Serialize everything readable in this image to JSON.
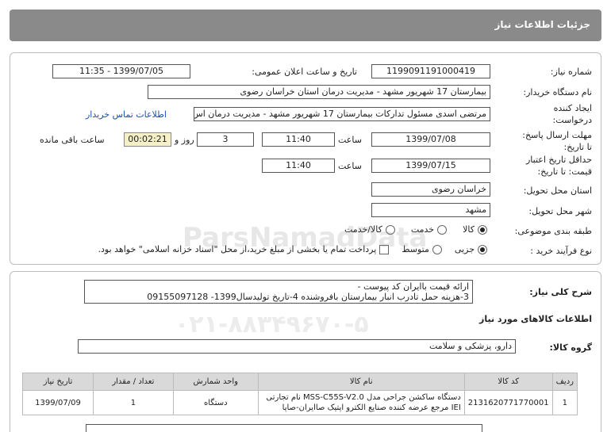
{
  "header": {
    "title": "جزئیات اطلاعات نیاز"
  },
  "need_number": {
    "label": "شماره نیاز:",
    "value": "1199091191000419"
  },
  "announce": {
    "label": "تاریخ و ساعت اعلان عمومی:",
    "value": "1399/07/05 - 11:35"
  },
  "buyer": {
    "label": "نام دستگاه خریدار:",
    "value": "بیمارستان 17 شهریور مشهد - مدیریت درمان استان خراسان رضوی"
  },
  "creator": {
    "label1": "ایجاد کننده",
    "label2": "درخواست:",
    "value": "مرتضی اسدی مسئول تدارکات بیمارستان 17 شهریور مشهد - مدیریت درمان اس",
    "contact_link": "اطلاعات تماس خریدار"
  },
  "deadline": {
    "label1": "مهلت ارسال پاسخ:",
    "label2": "تا تاریخ:",
    "date": "1399/07/08",
    "time_label": "ساعت",
    "time": "11:40",
    "days": "3",
    "days_label": "روز و",
    "remaining": "00:02:21",
    "remaining_label": "ساعت باقی مانده"
  },
  "validity": {
    "label1": "حداقل تاریخ اعتبار",
    "label2": "قیمت: تا تاریخ:",
    "date": "1399/07/15",
    "time_label": "ساعت",
    "time": "11:40"
  },
  "province": {
    "label": "استان محل تحویل:",
    "value": "خراسان رضوی"
  },
  "city": {
    "label": "شهر محل تحویل:",
    "value": "مشهد"
  },
  "category": {
    "label": "طبقه بندی موضوعی:",
    "options": [
      "کالا",
      "خدمت",
      "کالا/خدمت"
    ]
  },
  "process": {
    "label": "نوع فرآیند خرید :",
    "options": [
      "جزیی",
      "متوسط"
    ],
    "note": "پرداخت تمام یا بخشی از مبلغ خرید،از محل \"اسناد خزانه اسلامی\" خواهد بود."
  },
  "watermark": {
    "line1": "ParsNamadData",
    "line2": "۰۲۱-۸۸۳۴۹۶۷۰-۵"
  },
  "description": {
    "label": "شرح کلی نیاز:",
    "line1": "ارائه قیمت باایران کد پیوست -",
    "line2": "3-هزینه حمل تادرب انبار بیمارستان بافروشنده 4-تاریخ تولیدسال1399- 09155097128"
  },
  "goods_info": {
    "title": "اطلاعات کالاهای مورد نیاز"
  },
  "goods_group": {
    "label": "گروه کالا:",
    "value": "دارو، پزشکی و سلامت"
  },
  "table": {
    "headers": [
      "ردیف",
      "کد کالا",
      "نام کالا",
      "واحد شمارش",
      "تعداد / مقدار",
      "تاریخ نیاز"
    ],
    "rows": [
      [
        "1",
        "2131620771770001",
        "دستگاه ساکشن جراحی مدل MSS-C55S-V2.0 نام تجارتی IEI مرجع عرضه کننده صنایع الکترو اپتیک صاایران-صاپا",
        "دستگاه",
        "1",
        "1399/07/09"
      ]
    ]
  }
}
